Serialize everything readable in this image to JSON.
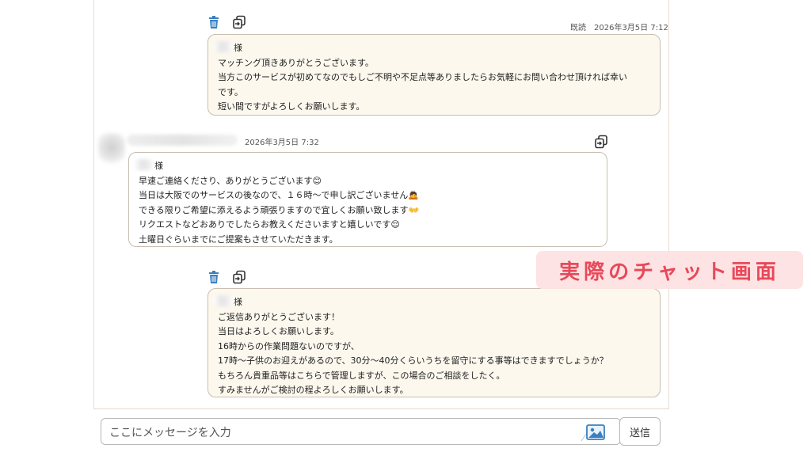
{
  "messages": [
    {
      "direction": "sent",
      "status": "既読",
      "timestamp": "2026年3月5日 7:12",
      "name_suffix": "様",
      "lines": [
        "マッチング頂きありがとうございます。",
        "当方このサービスが初めてなのでもしご不明や不足点等ありましたらお気軽にお問い合わせ頂ければ幸い",
        "です。",
        "短い間ですがよろしくお願いします。"
      ]
    },
    {
      "direction": "received",
      "timestamp": "2026年3月5日 7:32",
      "name_suffix": "様",
      "lines": [
        "早速ご連絡くださり、ありがとうございます😊",
        "当日は大阪でのサービスの後なので、１６時〜で申し訳ございません🙇",
        "できる限りご希望に添えるよう頑張りますので宜しくお願い致します👐",
        "リクエストなどおありでしたらお教えくださいますと嬉しいです😌",
        "土曜日ぐらいまでにご提案もさせていただきます。"
      ]
    },
    {
      "direction": "sent",
      "name_suffix": "様",
      "lines": [
        "ご返信ありがとうございます！",
        "当日はよろしくお願いします。",
        "16時からの作業問題ないのですが、",
        "17時〜子供のお迎えがあるので、30分〜40分くらいうちを留守にする事等はできますでしょうか？",
        "もちろん貴重品等はこちらで管理しますが、この場合のご相談をしたく。",
        "すみませんがご検討の程よろしくお願いします。"
      ]
    }
  ],
  "overlay_label": "実際のチャット画面",
  "composer": {
    "placeholder": "ここにメッセージを入力",
    "send_label": "送信"
  },
  "colors": {
    "icon_blue": "#3a7fc1",
    "sent_bubble_bg": "#fcf8ee",
    "label_bg": "#fde3e3",
    "label_text": "#e8495a"
  },
  "icons": [
    "trash-icon",
    "copy-icon",
    "image-icon"
  ]
}
